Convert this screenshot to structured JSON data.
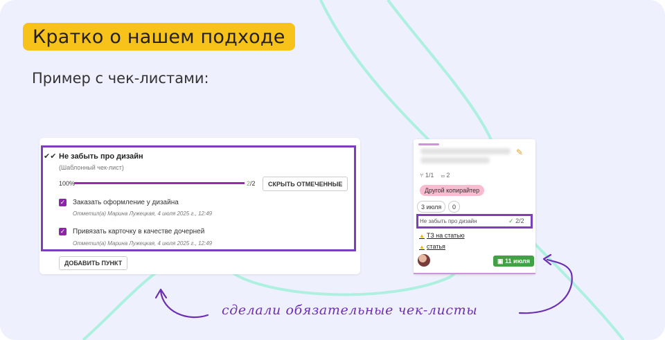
{
  "slide": {
    "title": "Кратко о нашем подходе",
    "subtitle": "Пример с чек-листами:",
    "handwritten_caption": "сделали обязательные чек-листы"
  },
  "checklist": {
    "title": "Не забыть про дизайн",
    "subtitle": "(Шаблонный чек-лист)",
    "progress_label": "100%",
    "progress": 1.0,
    "count_done": "2",
    "count_total": "/2",
    "hide_button": "СКРЫТЬ ОТМЕЧЕННЫЕ",
    "items": [
      {
        "label": "Заказать оформление у дизайна",
        "meta": "Отметил(а) Марина Лужецкая, 4 июля 2025 г., 12:49",
        "checked": true
      },
      {
        "label": "Привязать карточку в качестве дочерней",
        "meta": "Отметил(а) Марина Лужецкая, 4 июля 2025 г., 12:49",
        "checked": true
      }
    ],
    "add_button": "ДОБАВИТЬ ПУНКТ"
  },
  "kanban_card": {
    "subtasks": "1/1",
    "comments": "2",
    "tag": "Другой копирайтер",
    "date": "3 июля",
    "date_count": "0",
    "checklist_label": "Не забыть про дизайн",
    "checklist_count": "2/2",
    "links": [
      "ТЗ на статью",
      "статья"
    ],
    "due": "11 июля"
  },
  "colors": {
    "background": "#eef0fd",
    "title_pill": "#f7c21a",
    "highlight": "#7b3fbc",
    "accent_purple": "#9c27b0",
    "due_green": "#43a047",
    "tag_pink": "#f8bbd0"
  }
}
